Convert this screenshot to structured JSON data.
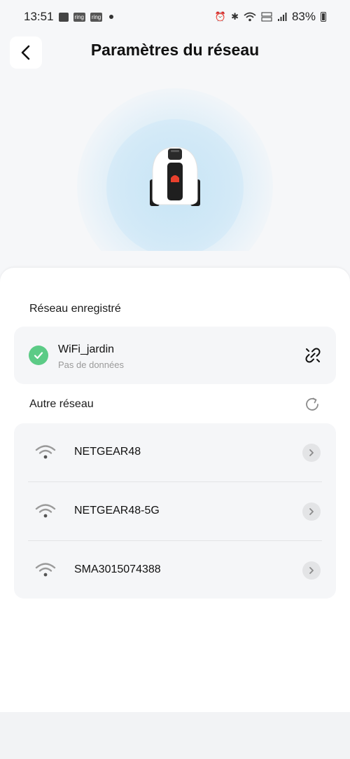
{
  "status_bar": {
    "time": "13:51",
    "notif_ring_1": "ring",
    "notif_ring_2": "ring",
    "battery": "83%"
  },
  "header": {
    "title": "Paramètres du réseau"
  },
  "saved_section": {
    "label": "Réseau enregistré",
    "network": {
      "name": "WiFi_jardin",
      "status": "Pas de données"
    }
  },
  "other_section": {
    "label": "Autre réseau",
    "networks": [
      {
        "name": "NETGEAR48"
      },
      {
        "name": "NETGEAR48-5G"
      },
      {
        "name": "SMA3015074388"
      }
    ]
  },
  "colors": {
    "accent_green": "#5ccb86",
    "background": "#f6f7f9",
    "card": "#f5f6f8"
  }
}
